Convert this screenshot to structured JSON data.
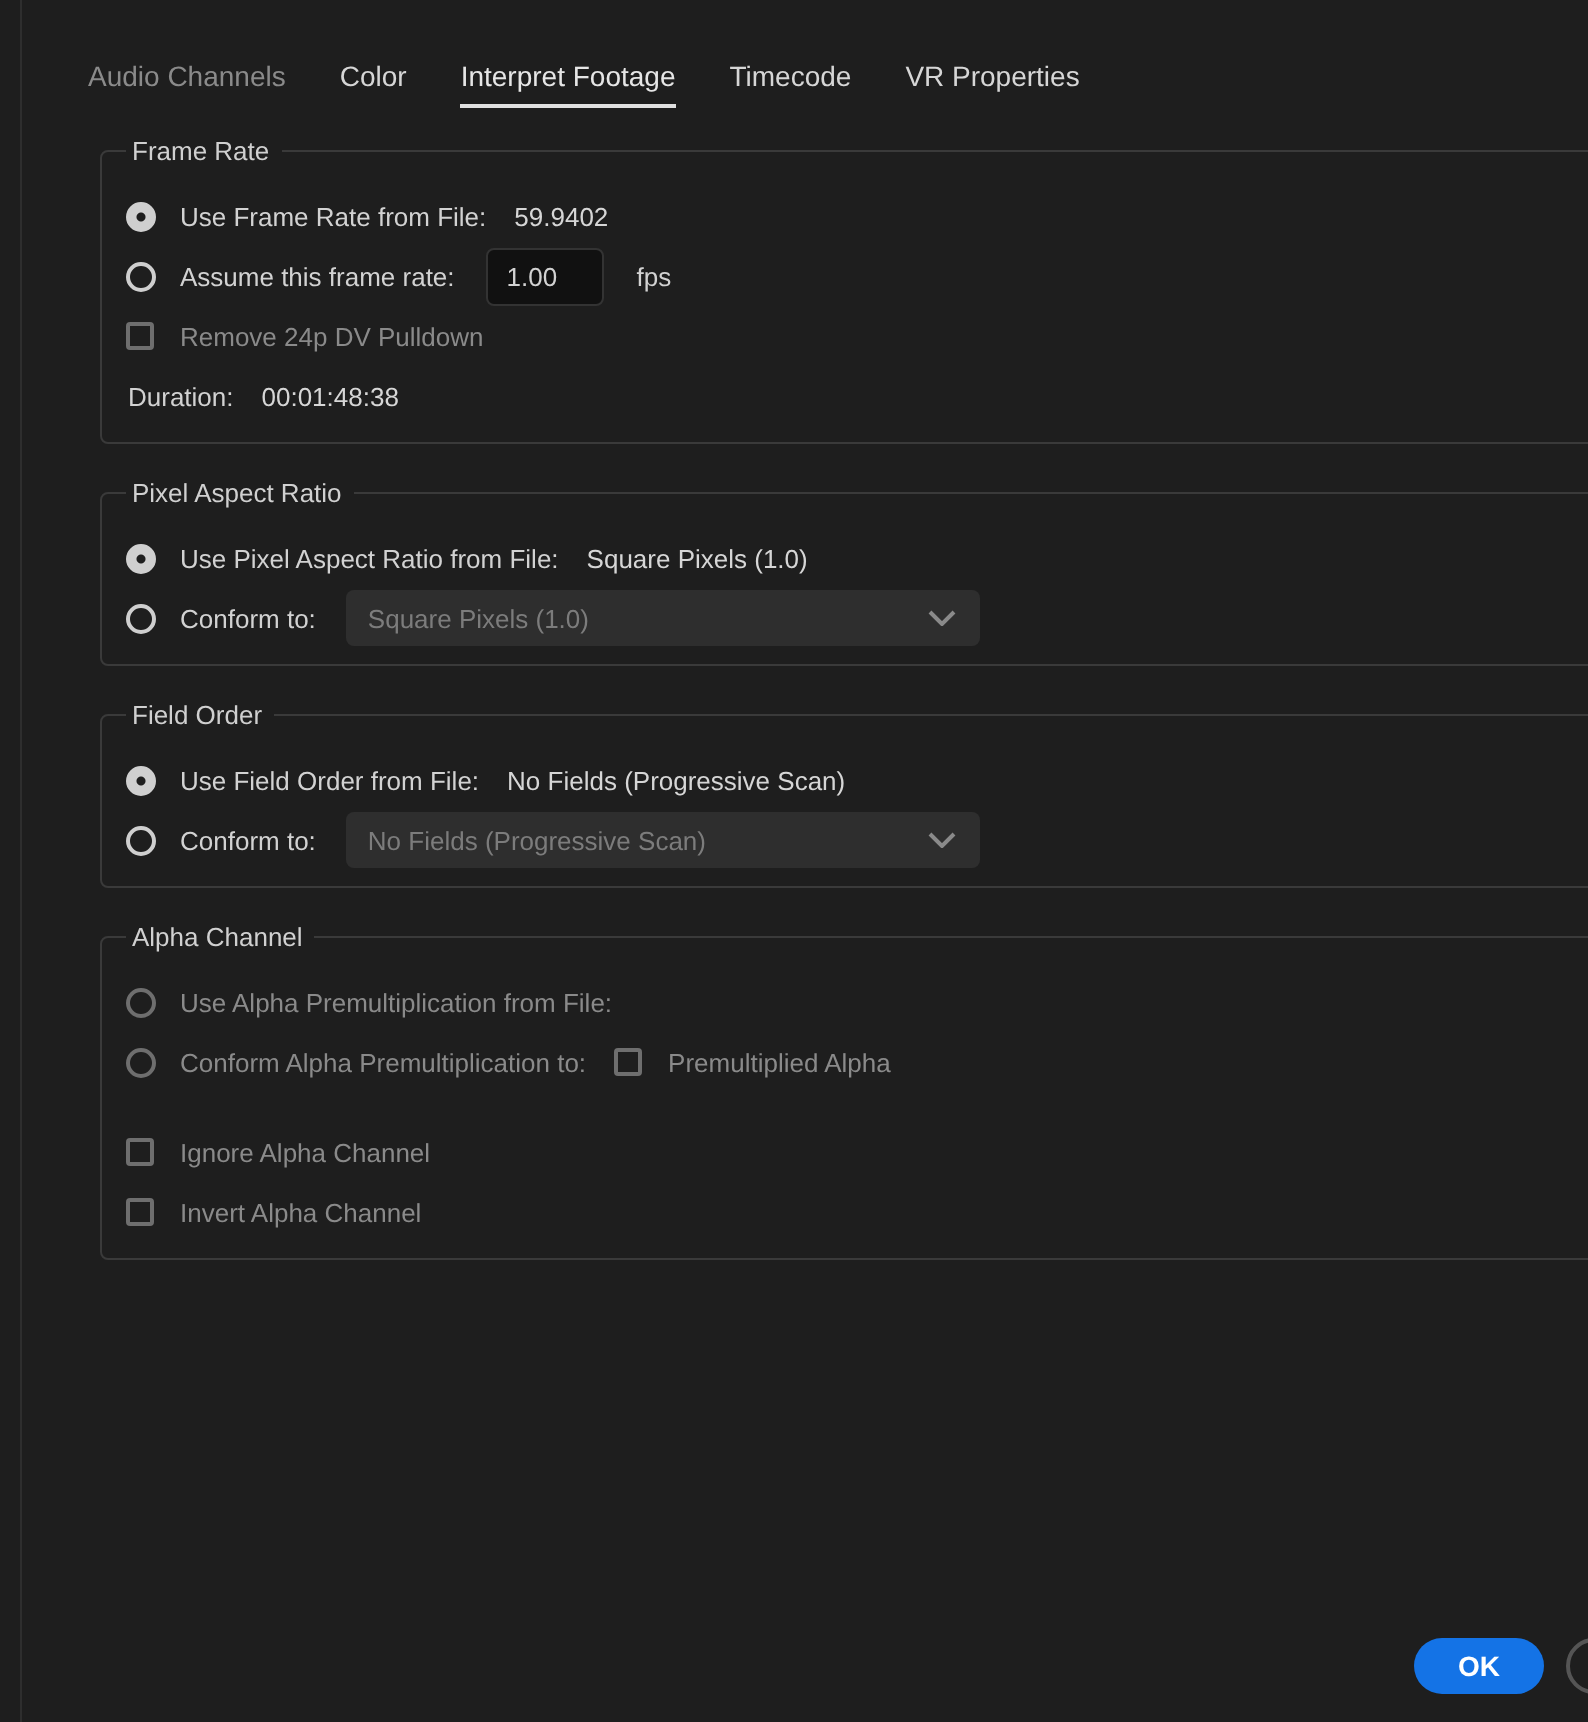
{
  "tabs": [
    {
      "label": "Audio Channels",
      "selected": false,
      "disabled": true
    },
    {
      "label": "Color",
      "selected": false,
      "disabled": false
    },
    {
      "label": "Interpret Footage",
      "selected": true,
      "disabled": false
    },
    {
      "label": "Timecode",
      "selected": false,
      "disabled": false
    },
    {
      "label": "VR Properties",
      "selected": false,
      "disabled": false
    }
  ],
  "sections": [
    {
      "title": "Frame Rate",
      "rows": [
        {
          "kind": "radio",
          "label": "Use Frame Rate from File:",
          "selected": true,
          "disabled": false,
          "value": "59.9402"
        },
        {
          "kind": "radio",
          "label": "Assume this frame rate:",
          "selected": false,
          "disabled": false,
          "input": {
            "value": "1.00",
            "unit": "fps"
          }
        },
        {
          "kind": "checkbox",
          "label": "Remove 24p DV Pulldown",
          "checked": false,
          "disabled": true
        },
        {
          "kind": "info",
          "label": "Duration:",
          "value": "00:01:48:38"
        }
      ]
    },
    {
      "title": "Pixel Aspect Ratio",
      "rows": [
        {
          "kind": "radio",
          "label": "Use Pixel Aspect Ratio from File:",
          "selected": true,
          "disabled": false,
          "value": "Square Pixels (1.0)"
        },
        {
          "kind": "radio",
          "label": "Conform to:",
          "selected": false,
          "disabled": false,
          "dropdown": {
            "value": "Square Pixels (1.0)",
            "disabled": true
          }
        }
      ]
    },
    {
      "title": "Field Order",
      "rows": [
        {
          "kind": "radio",
          "label": "Use Field Order from File:",
          "selected": true,
          "disabled": false,
          "value": "No Fields (Progressive Scan)"
        },
        {
          "kind": "radio",
          "label": "Conform to:",
          "selected": false,
          "disabled": false,
          "dropdown": {
            "value": "No Fields (Progressive Scan)",
            "disabled": true
          }
        }
      ]
    },
    {
      "title": "Alpha Channel",
      "rows": [
        {
          "kind": "radio",
          "label": "Use Alpha Premultiplication from File:",
          "selected": false,
          "disabled": true
        },
        {
          "kind": "radio",
          "label": "Conform Alpha Premultiplication to:",
          "selected": false,
          "disabled": true,
          "checkbox": {
            "label": "Premultiplied Alpha",
            "checked": false
          }
        },
        {
          "kind": "spacer"
        },
        {
          "kind": "checkbox",
          "label": "Ignore Alpha Channel",
          "checked": false,
          "disabled": true
        },
        {
          "kind": "checkbox",
          "label": "Invert Alpha Channel",
          "checked": false,
          "disabled": true
        }
      ]
    }
  ],
  "buttons": [
    {
      "label": "OK",
      "kind": "primary"
    },
    {
      "kind": "secondary"
    }
  ]
}
